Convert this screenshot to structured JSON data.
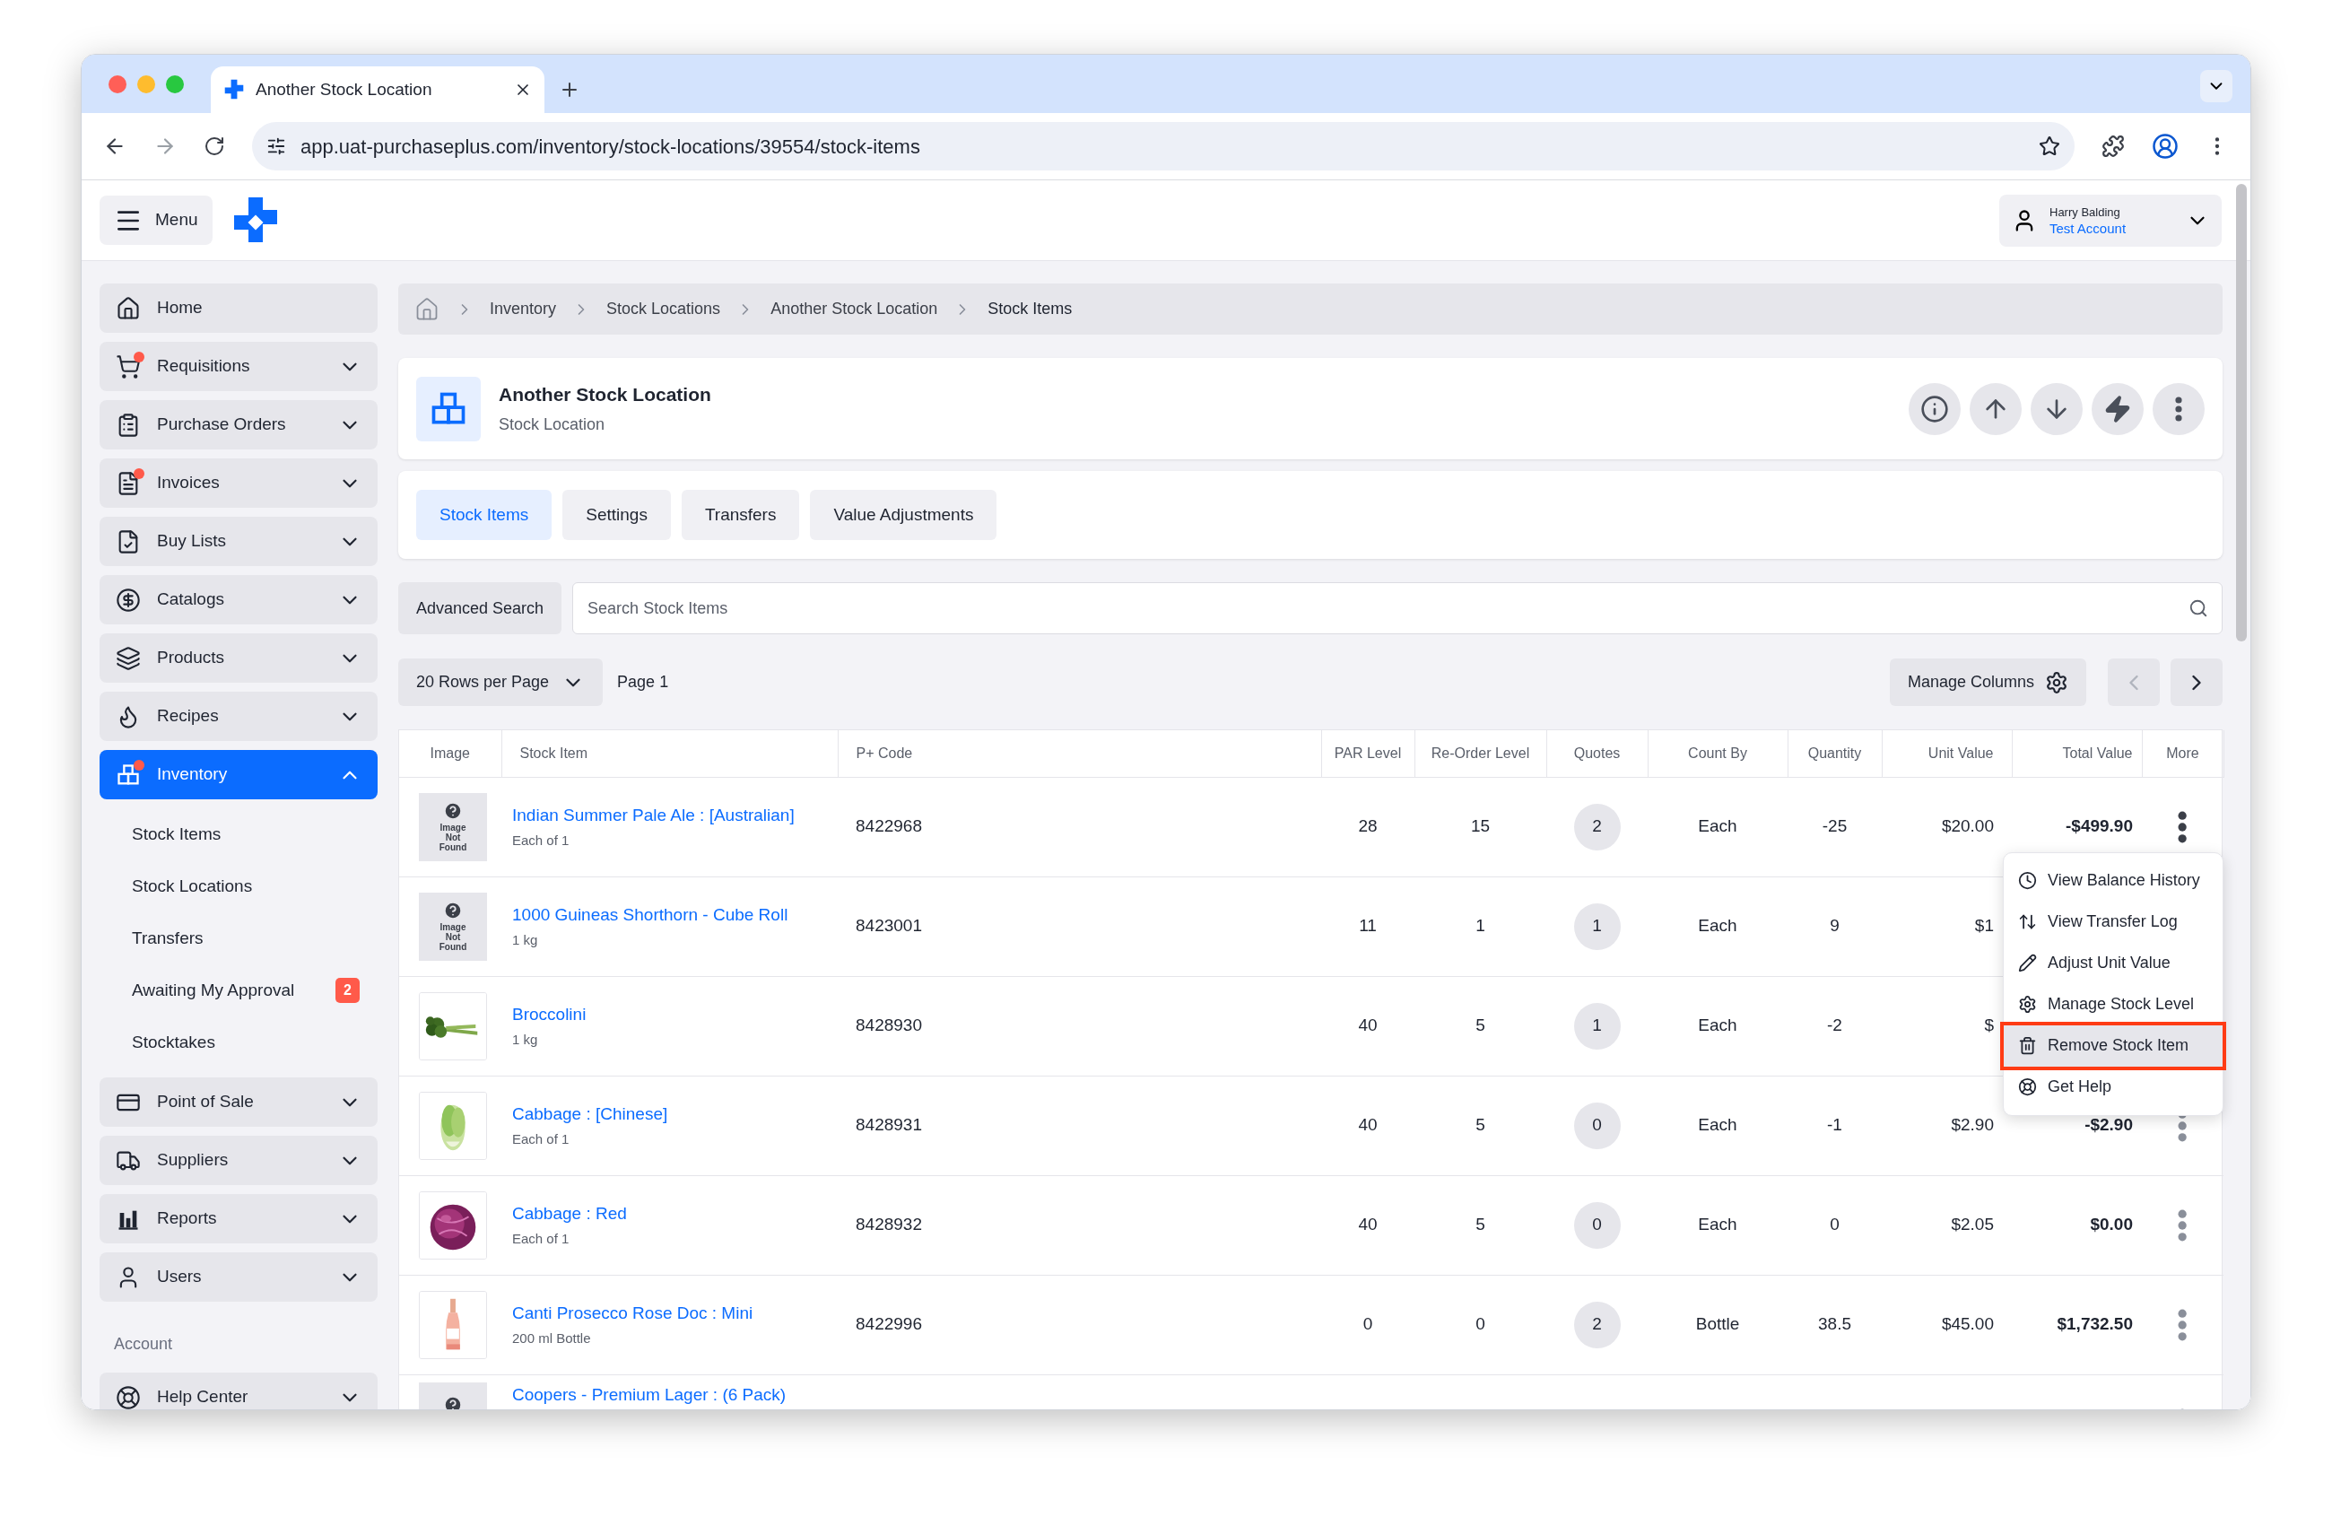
{
  "browser": {
    "tab_title": "Another Stock Location",
    "url": "app.uat-purchaseplus.com/inventory/stock-locations/39554/stock-items"
  },
  "header": {
    "menu_label": "Menu",
    "user_name": "Harry Balding",
    "account": "Test Account"
  },
  "sidebar": {
    "items": [
      {
        "label": "Home",
        "selected": false,
        "notify": false
      },
      {
        "label": "Requisitions",
        "expanded": false,
        "selected": false,
        "notify": true
      },
      {
        "label": "Purchase Orders",
        "expanded": false,
        "selected": false,
        "notify": false
      },
      {
        "label": "Invoices",
        "expanded": false,
        "selected": false,
        "notify": true
      },
      {
        "label": "Buy Lists",
        "expanded": false,
        "selected": false,
        "notify": false
      },
      {
        "label": "Catalogs",
        "expanded": false,
        "selected": false,
        "notify": false
      },
      {
        "label": "Products",
        "expanded": false,
        "selected": false,
        "notify": false
      },
      {
        "label": "Recipes",
        "expanded": false,
        "selected": false,
        "notify": false
      },
      {
        "label": "Inventory",
        "expanded": true,
        "selected": true,
        "notify": true,
        "children": [
          {
            "label": "Stock Items",
            "selected": false
          },
          {
            "label": "Stock Locations",
            "selected": false
          },
          {
            "label": "Transfers",
            "selected": false
          },
          {
            "label": "Awaiting My Approval",
            "selected": false,
            "badge": "2"
          },
          {
            "label": "Stocktakes",
            "selected": false
          }
        ]
      },
      {
        "label": "Point of Sale",
        "expanded": false,
        "selected": false,
        "notify": false
      },
      {
        "label": "Suppliers",
        "expanded": false,
        "selected": false,
        "notify": false
      },
      {
        "label": "Reports",
        "expanded": false,
        "selected": false,
        "notify": false
      },
      {
        "label": "Users",
        "expanded": false,
        "selected": false,
        "notify": false
      }
    ],
    "section_label": "Account",
    "footer_items": [
      {
        "label": "Help Center",
        "expanded": false,
        "selected": false,
        "notify": false
      }
    ]
  },
  "breadcrumb": [
    "Inventory",
    "Stock Locations",
    "Another Stock Location",
    "Stock Items"
  ],
  "location": {
    "title": "Another Stock Location",
    "subtitle": "Stock Location"
  },
  "tabs": [
    {
      "label": "Stock Items",
      "selected": true
    },
    {
      "label": "Settings",
      "selected": false
    },
    {
      "label": "Transfers",
      "selected": false
    },
    {
      "label": "Value Adjustments",
      "selected": false
    }
  ],
  "search": {
    "button": "Advanced Search",
    "placeholder": "Search Stock Items"
  },
  "pagination": {
    "rows_per_page": "20 Rows per Page",
    "page": "Page 1",
    "manage_columns": "Manage Columns",
    "previous": {
      "disabled": true
    },
    "next": {
      "disabled": false
    }
  },
  "table": {
    "columns": [
      "Image",
      "Stock Item",
      "P+ Code",
      "PAR Level",
      "Re-Order Level",
      "Quotes",
      "Count By",
      "Quantity",
      "Unit Value",
      "Total Value",
      "More"
    ],
    "rows": [
      {
        "image": {
          "kind": "not_found",
          "text": "Image Not Found"
        },
        "name": "Indian Summer Pale Ale : [Australian]",
        "unit": "Each of 1",
        "code": "8422968",
        "par": "28",
        "reorder": "15",
        "quotes": "2",
        "count_by": "Each",
        "quantity": "-25",
        "unit_value": "$20.00",
        "total_value": "-$499.90",
        "menu_open": true
      },
      {
        "image": {
          "kind": "not_found",
          "text": "Image Not Found"
        },
        "name": "1000 Guineas Shorthorn - Cube Roll",
        "unit": "1 kg",
        "code": "8423001",
        "par": "11",
        "reorder": "1",
        "quotes": "1",
        "count_by": "Each",
        "quantity": "9",
        "unit_value": "$1"
      },
      {
        "name": "Broccolini",
        "unit": "1 kg",
        "code": "8428930",
        "par": "40",
        "reorder": "5",
        "quotes": "1",
        "count_by": "Each",
        "quantity": "-2",
        "unit_value": "$"
      },
      {
        "name": "Cabbage : [Chinese]",
        "unit": "Each of 1",
        "code": "8428931",
        "par": "40",
        "reorder": "5",
        "quotes": "0",
        "count_by": "Each",
        "quantity": "-1",
        "unit_value": "$2.90",
        "total_value": "-$2.90",
        "menu_open": false
      },
      {
        "name": "Cabbage : Red",
        "unit": "Each of 1",
        "code": "8428932",
        "par": "40",
        "reorder": "5",
        "quotes": "0",
        "count_by": "Each",
        "quantity": "0",
        "unit_value": "$2.05",
        "total_value": "$0.00",
        "menu_open": false
      },
      {
        "name": "Canti Prosecco Rose Doc : Mini",
        "unit": "200 ml Bottle",
        "code": "8422996",
        "par": "0",
        "reorder": "0",
        "quotes": "2",
        "count_by": "Bottle",
        "quantity": "38.5",
        "unit_value": "$45.00",
        "total_value": "$1,732.50",
        "menu_open": false
      },
      {
        "image": {
          "kind": "not_found"
        },
        "name": "Coopers - Premium Lager : (6 Pack)",
        "menu_open": false
      }
    ]
  },
  "row_menu": {
    "items": [
      {
        "label": "View Balance History",
        "highlighted": false
      },
      {
        "label": "View Transfer Log",
        "highlighted": false
      },
      {
        "label": "Adjust Unit Value",
        "highlighted": false
      },
      {
        "label": "Manage Stock Level",
        "highlighted": false
      },
      {
        "label": "Remove Stock Item",
        "highlighted": true
      },
      {
        "label": "Get Help",
        "highlighted": false
      }
    ]
  }
}
